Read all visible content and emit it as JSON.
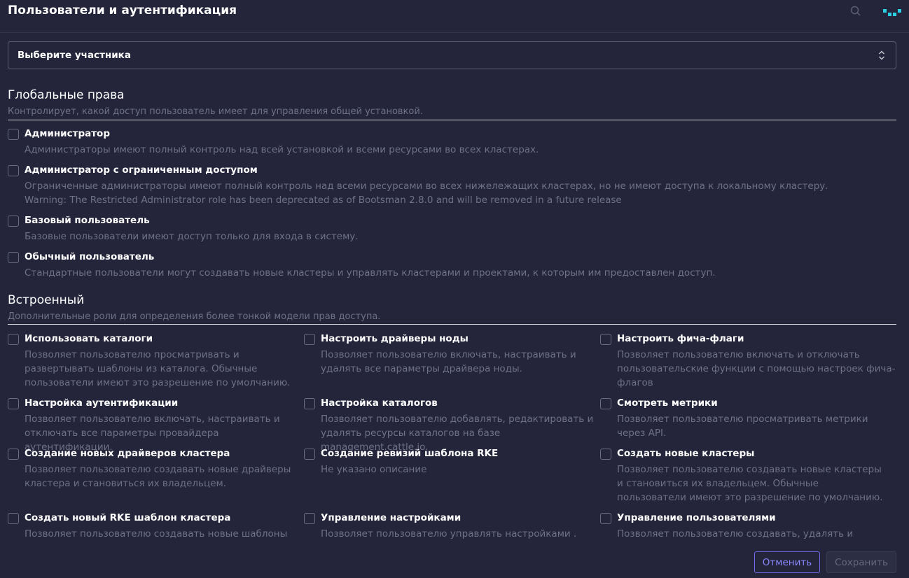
{
  "header": {
    "title": "Пользователи и аутентификация"
  },
  "member_select": {
    "value": "Выберите участника"
  },
  "global": {
    "title": "Глобальные права",
    "subtitle": "Контролирует, какой доступ пользователь имеет для управления общей установкой.",
    "options": [
      {
        "label": "Администратор",
        "desc": [
          "Администраторы имеют полный контроль над всей установкой и всеми ресурсами во всех кластерах."
        ],
        "checked": false
      },
      {
        "label": "Администратор с ограниченным доступом",
        "desc": [
          "Ограниченные администраторы имеют полный контроль над всеми ресурсами во всех нижележащих кластерах, но не имеют доступа к локальному кластеру.",
          "Warning: The Restricted Administrator role has been deprecated as of Bootsman 2.8.0 and will be removed in a future release"
        ],
        "checked": false
      },
      {
        "label": "Базовый пользователь",
        "desc": [
          "Базовые пользователи имеют доступ только для входа в систему."
        ],
        "checked": false
      },
      {
        "label": "Обычный пользователь",
        "desc": [
          "Стандартные пользователи могут создавать новые кластеры и управлять кластерами и проектами, к которым им предоставлен доступ."
        ],
        "checked": false
      }
    ]
  },
  "builtin": {
    "title": "Встроенный",
    "subtitle": "Дополнительные роли для определения более тонкой модели прав доступа.",
    "options": [
      {
        "label": "Использовать каталоги",
        "desc": "Позволяет пользователю просматривать и развертывать шаблоны из каталога. Обычные пользователи имеют это разрешение по умолчанию."
      },
      {
        "label": "Настроить драйверы ноды",
        "desc": "Позволяет пользователю включать, настраивать и удалять все параметры драйвера ноды."
      },
      {
        "label": "Настроить фича-флаги",
        "desc": "Позволяет пользователю включать и отключать пользовательские функции с помощью настроек фича-флагов"
      },
      {
        "label": "Настройка аутентификации",
        "desc": "Позволяет пользователю включать, настраивать и отключать все параметры провайдера аутентификации."
      },
      {
        "label": "Настройка каталогов",
        "desc": "Позволяет пользователю добавлять, редактировать и удалять ресурсы каталогов на базе management.cattle.io."
      },
      {
        "label": "Смотреть метрики",
        "desc": "Позволяет пользователю просматривать метрики через API."
      },
      {
        "label": "Создание новых драйверов кластера",
        "desc": "Позволяет пользователю создавать новые драйверы кластера и становиться их владельцем."
      },
      {
        "label": "Создание ревизий шаблона RKE",
        "desc": "Не указано описание"
      },
      {
        "label": "Создать новые кластеры",
        "desc": "Позволяет пользователю создавать новые кластеры и становиться их владельцем. Обычные пользователи имеют это разрешение по умолчанию."
      },
      {
        "label": "Создать новый RKE шаблон кластера",
        "desc": "Позволяет пользователю создавать новые шаблоны"
      },
      {
        "label": "Управление настройками",
        "desc": "Позволяет пользователю управлять настройками ."
      },
      {
        "label": "Управление пользователями",
        "desc": "Позволяет пользователю создавать, удалять и"
      }
    ]
  },
  "footer": {
    "cancel_label": "Отменить",
    "save_label": "Сохранить"
  },
  "icons": {
    "search": "search-icon",
    "logo": "logo-icon",
    "chevron": "chevron-updown-icon"
  },
  "colors": {
    "background": "#24253a",
    "accent": "#6f6cf0",
    "muted_text": "#6f7186",
    "logo": "#2ad1e6"
  }
}
